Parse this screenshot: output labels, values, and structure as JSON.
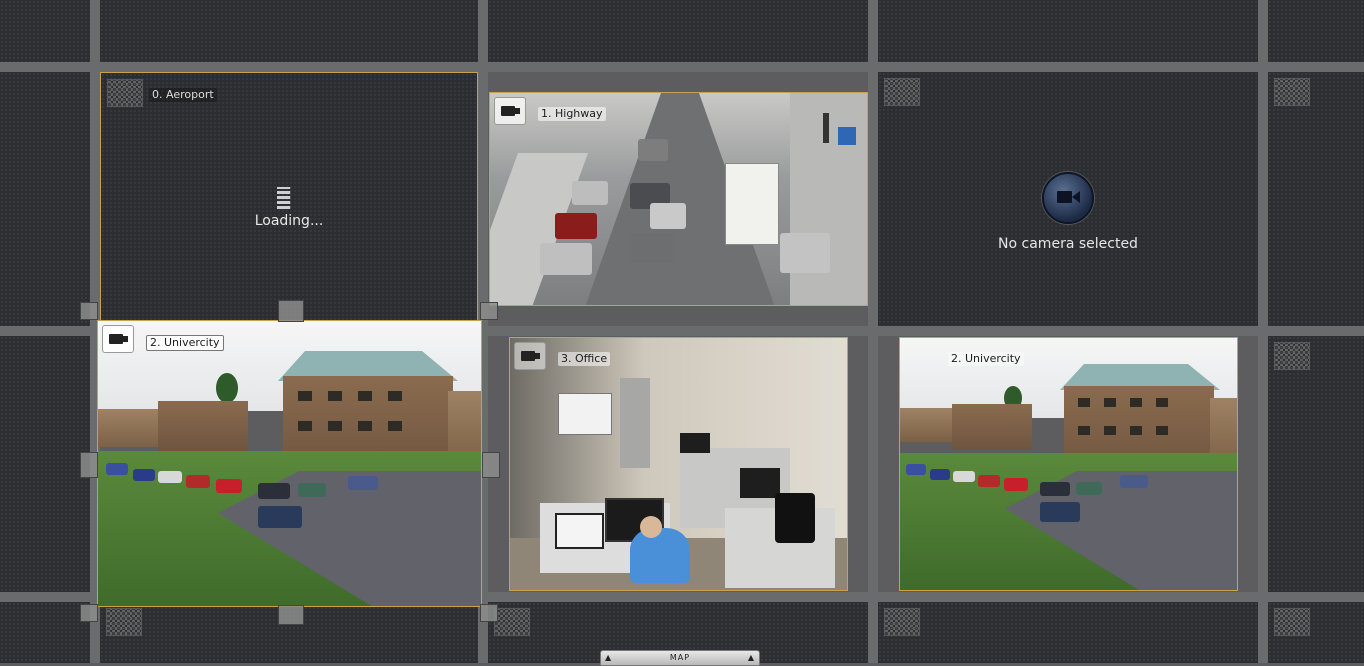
{
  "panels": {
    "aeroport": {
      "label": "0. Aeroport",
      "status": "Loading..."
    },
    "highway": {
      "label": "1. Highway"
    },
    "empty_slot": {
      "status": "No camera selected"
    },
    "univercity_main": {
      "label": "2. Univercity"
    },
    "office": {
      "label": "3. Office"
    },
    "univercity_copy": {
      "label": "2. Univercity"
    }
  },
  "map_tab": {
    "label": "MAP",
    "left_arrow": "▲",
    "right_arrow": "▲"
  },
  "colors": {
    "accent_border": "#c9a24a",
    "background": "#2d2e31",
    "grid_line": "#6a6b6d"
  },
  "icons": [
    "grid-layout-icon",
    "camera-icon",
    "loading-spinner-icon",
    "no-camera-icon"
  ]
}
